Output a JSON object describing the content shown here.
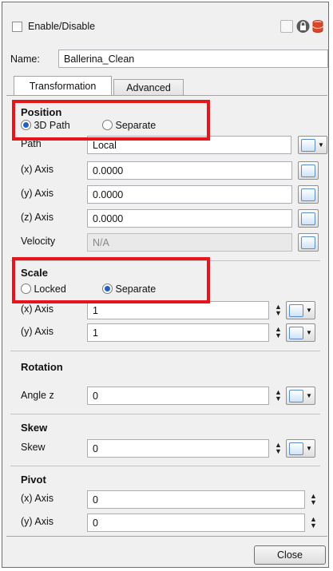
{
  "header": {
    "enable_label": "Enable/Disable",
    "icons": [
      "blank-toggle-icon",
      "lock-icon",
      "database-icon"
    ]
  },
  "name_row": {
    "label": "Name:",
    "value": "Ballerina_Clean"
  },
  "tabs": [
    {
      "label": "Transformation",
      "active": true
    },
    {
      "label": "Advanced",
      "active": false
    }
  ],
  "position": {
    "title": "Position",
    "radio_3d_path": "3D Path",
    "radio_separate": "Separate",
    "selected": "3D Path",
    "path_label": "Path",
    "path_value": "Local",
    "x_label": "(x) Axis",
    "x_value": "0.0000",
    "y_label": "(y) Axis",
    "y_value": "0.0000",
    "z_label": "(z) Axis",
    "z_value": "0.0000",
    "velocity_label": "Velocity",
    "velocity_value": "N/A"
  },
  "scale": {
    "title": "Scale",
    "radio_locked": "Locked",
    "radio_separate": "Separate",
    "selected": "Separate",
    "x_label": "(x) Axis",
    "x_value": "1",
    "y_label": "(y) Axis",
    "y_value": "1"
  },
  "rotation": {
    "title": "Rotation",
    "angle_label": "Angle z",
    "angle_value": "0"
  },
  "skew": {
    "title": "Skew",
    "skew_label": "Skew",
    "skew_value": "0"
  },
  "pivot": {
    "title": "Pivot",
    "x_label": "(x) Axis",
    "x_value": "0",
    "y_label": "(y) Axis",
    "y_value": "0"
  },
  "footer": {
    "close_label": "Close"
  },
  "colors": {
    "highlight": "#e8141b",
    "radio_selected": "#1f60c4"
  }
}
